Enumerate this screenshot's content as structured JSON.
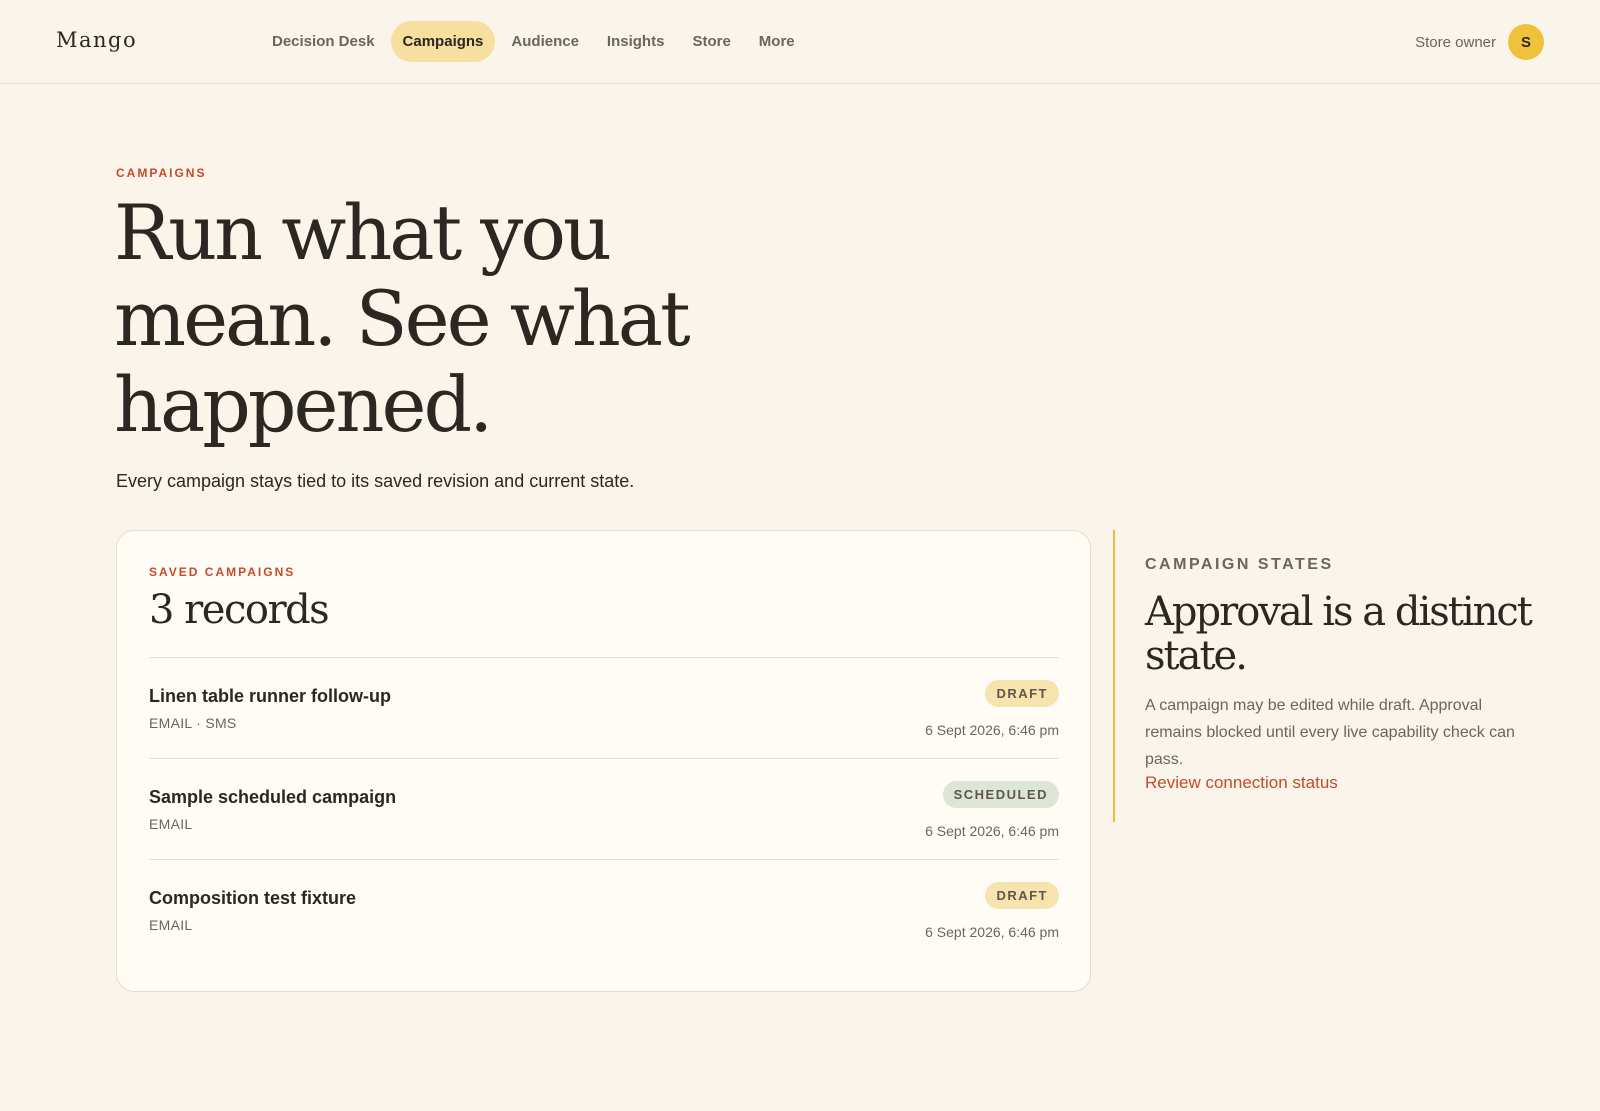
{
  "app": {
    "brand": "Mango"
  },
  "nav": {
    "items": [
      {
        "label": "Decision Desk",
        "active": false
      },
      {
        "label": "Campaigns",
        "active": true
      },
      {
        "label": "Audience",
        "active": false
      },
      {
        "label": "Insights",
        "active": false
      },
      {
        "label": "Store",
        "active": false
      },
      {
        "label": "More",
        "active": false
      }
    ]
  },
  "account": {
    "label": "Store owner",
    "initial": "S"
  },
  "hero": {
    "eyebrow": "CAMPAIGNS",
    "title": "Run what you mean. See what happened.",
    "subtitle": "Every campaign stays tied to its saved revision and current state."
  },
  "saved": {
    "eyebrow": "SAVED CAMPAIGNS",
    "count_label": "3 records",
    "records": [
      {
        "name": "Linen table runner follow-up",
        "channels": "EMAIL · SMS",
        "status": "DRAFT",
        "status_kind": "draft",
        "updated": "6 Sept 2026, 6:46 pm"
      },
      {
        "name": "Sample scheduled campaign",
        "channels": "EMAIL",
        "status": "SCHEDULED",
        "status_kind": "scheduled",
        "updated": "6 Sept 2026, 6:46 pm"
      },
      {
        "name": "Composition test fixture",
        "channels": "EMAIL",
        "status": "DRAFT",
        "status_kind": "draft",
        "updated": "6 Sept 2026, 6:46 pm"
      }
    ]
  },
  "states_panel": {
    "eyebrow": "CAMPAIGN STATES",
    "title": "Approval is a distinct state.",
    "body": "A campaign may be edited while draft. Approval remains blocked until every live capability check can pass.",
    "link": "Review connection status"
  },
  "colors": {
    "background": "#fbf4ea",
    "accent": "#c44b2b",
    "nav_active": "#f7df9f",
    "avatar": "#f0c23c",
    "draft_badge": "#f7e3ad",
    "scheduled_badge": "#dce5d6",
    "panel_rule": "#efb93a"
  }
}
